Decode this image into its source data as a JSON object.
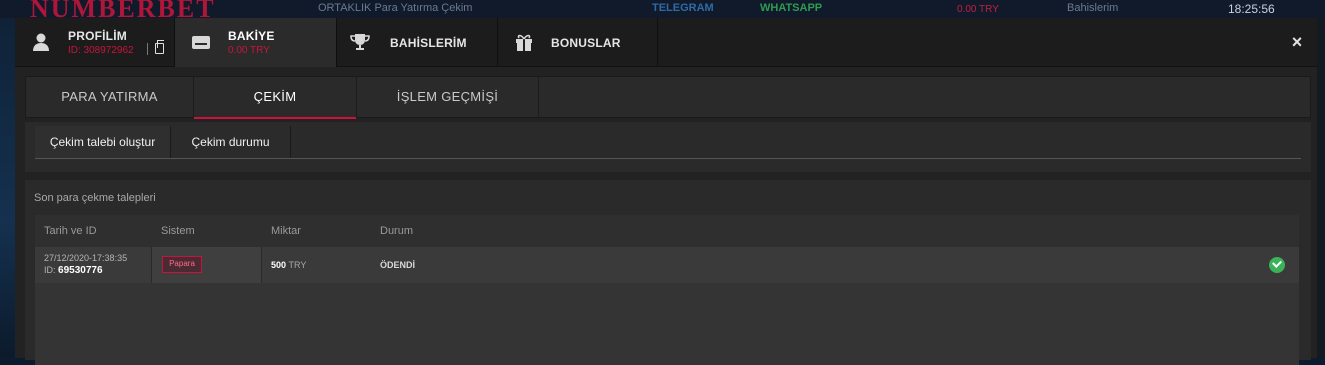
{
  "background": {
    "logo": "NUMBERBET",
    "topnav": "ORTAKLIK   Para Yatırma   Çekim",
    "telegram": "TELEGRAM",
    "whatsapp": "WHATSAPP",
    "balance": "0.00 TRY",
    "bets": "Bahislerim",
    "clock": "18:25:56"
  },
  "header": {
    "tabs": [
      {
        "title": "PROFİLİM",
        "sub": "ID: 308972962",
        "icon": "user-icon"
      },
      {
        "title": "BAKİYE",
        "sub": "0.00 TRY",
        "icon": "wallet-icon"
      },
      {
        "title": "BAHİSLERİM",
        "icon": "trophy-icon"
      },
      {
        "title": "BONUSLAR",
        "icon": "gift-icon"
      }
    ],
    "close": "×"
  },
  "panel": {
    "tabs": [
      "PARA YATIRMA",
      "ÇEKİM",
      "İŞLEM GEÇMİŞİ"
    ],
    "active_tab": "ÇEKİM"
  },
  "subtabs": [
    "Çekim talebi oluştur",
    "Çekim durumu"
  ],
  "history": {
    "title": "Son para çekme talepleri",
    "columns": [
      "Tarih ve ID",
      "Sistem",
      "Miktar",
      "Durum"
    ],
    "rows": [
      {
        "date": "27/12/2020-17:38:35",
        "id_label": "ID:",
        "id": "69530776",
        "system": "Papara",
        "amount": "500",
        "currency": "TRY",
        "status": "ÖDENDİ"
      }
    ]
  },
  "colors": {
    "accent": "#c8143c",
    "success": "#3bb25a",
    "panel": "#2a2a2a"
  }
}
